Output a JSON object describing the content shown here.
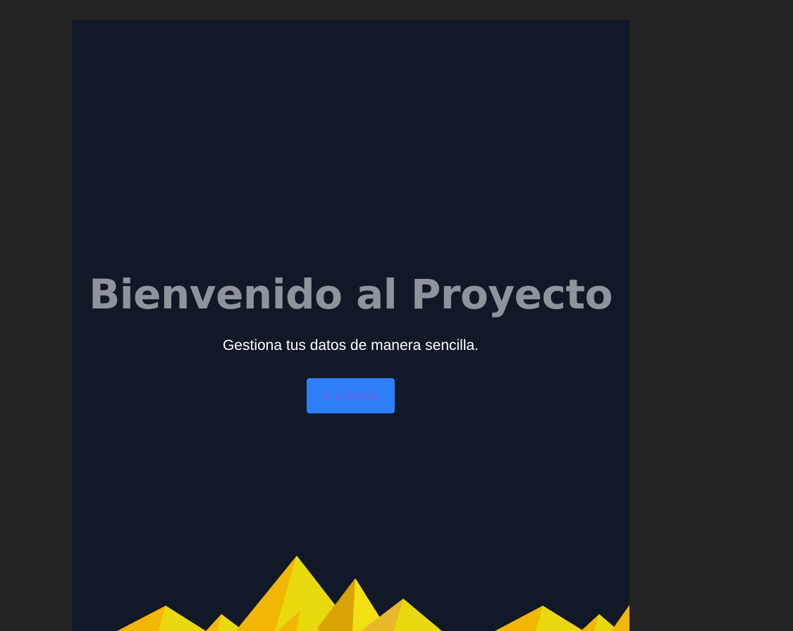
{
  "hero": {
    "title": "Bienvenido al Proyecto",
    "subtitle": "Gestiona tus datos de manera sencilla.",
    "button_label": "Ir a Items"
  },
  "colors": {
    "page_background": "#232323",
    "viewport_background": "#111827",
    "title": "#8f949c",
    "subtitle": "#ffffff",
    "button_background": "#2e7ff7",
    "button_text": "#5a68e8",
    "mountain_gold": "#f2b705",
    "mountain_yellow": "#e8d90c",
    "mountain_dark_gold": "#d9a306"
  },
  "decoration": {
    "name": "mountains-illustration"
  }
}
